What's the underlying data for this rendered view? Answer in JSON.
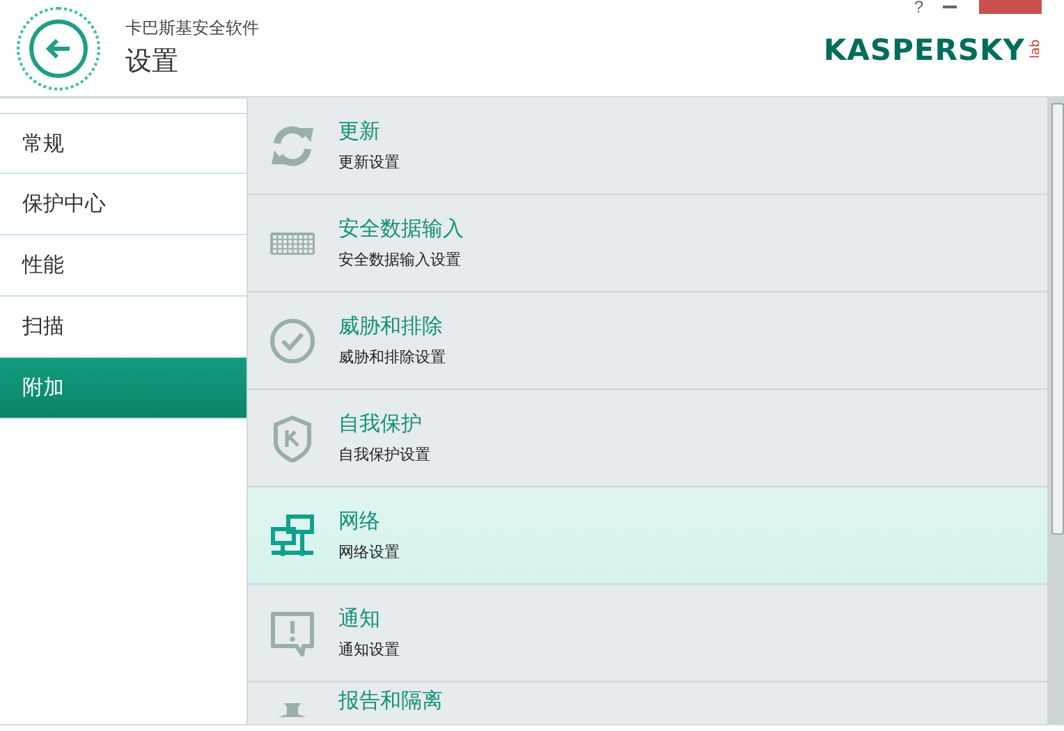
{
  "window": {
    "help": "?"
  },
  "header": {
    "product": "卡巴斯基安全软件",
    "title": "设置",
    "logo": {
      "text": "KASPERSKY",
      "suffix": "lab"
    }
  },
  "sidebar": {
    "items": [
      {
        "label": "常规",
        "selected": false
      },
      {
        "label": "保护中心",
        "selected": false
      },
      {
        "label": "性能",
        "selected": false
      },
      {
        "label": "扫描",
        "selected": false
      },
      {
        "label": "附加",
        "selected": true
      }
    ]
  },
  "sections": [
    {
      "kind": "refresh",
      "title": "更新",
      "subtitle": "更新设置",
      "selected": false
    },
    {
      "kind": "keyboard",
      "title": "安全数据输入",
      "subtitle": "安全数据输入设置",
      "selected": false
    },
    {
      "kind": "check",
      "title": "威胁和排除",
      "subtitle": "威胁和排除设置",
      "selected": false
    },
    {
      "kind": "shield",
      "title": "自我保护",
      "subtitle": "自我保护设置",
      "selected": false
    },
    {
      "kind": "network",
      "title": "网络",
      "subtitle": "网络设置",
      "selected": true
    },
    {
      "kind": "alert",
      "title": "通知",
      "subtitle": "通知设置",
      "selected": false
    },
    {
      "kind": "pin",
      "title": "报告和隔离",
      "selected": false
    }
  ]
}
